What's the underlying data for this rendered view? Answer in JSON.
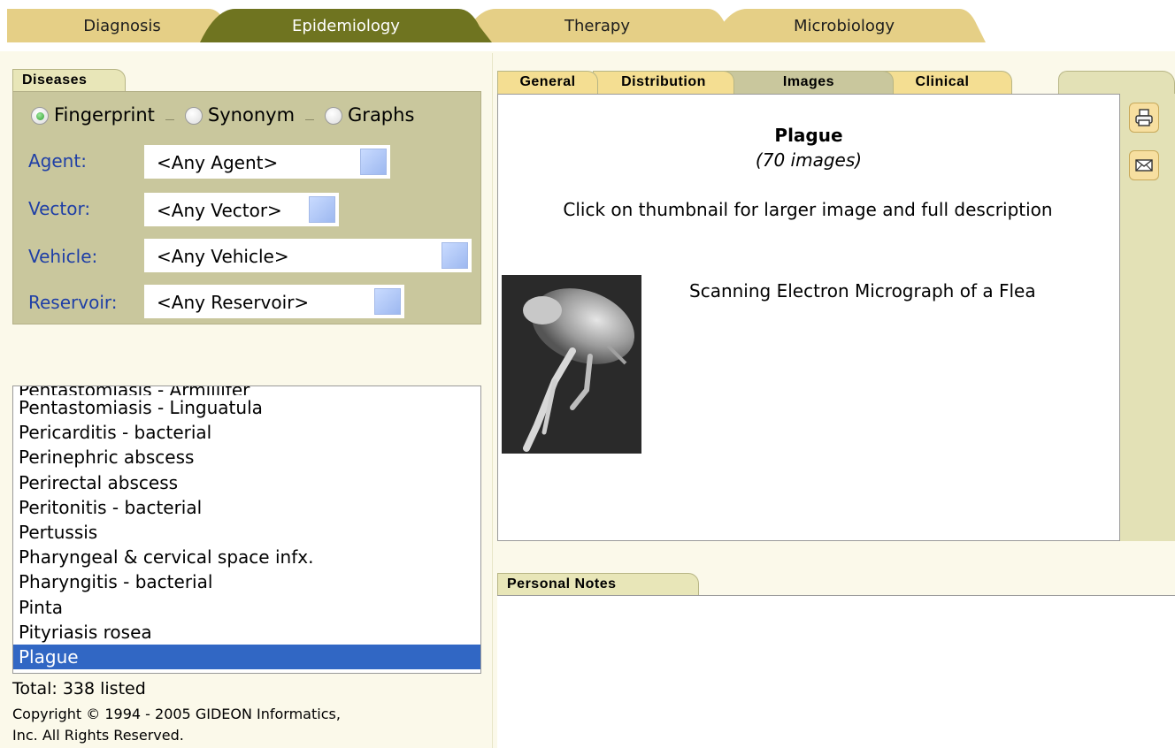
{
  "module_tabs": [
    {
      "label": "Diagnosis",
      "active": false
    },
    {
      "label": "Epidemiology",
      "active": true
    },
    {
      "label": "Therapy",
      "active": false
    },
    {
      "label": "Microbiology",
      "active": false
    }
  ],
  "left": {
    "panel_title": "Diseases",
    "radios": [
      {
        "label": "Fingerprint",
        "selected": true
      },
      {
        "label": "Synonym",
        "selected": false
      },
      {
        "label": "Graphs",
        "selected": false
      }
    ],
    "filters": {
      "agent": {
        "label": "Agent:",
        "value": "<Any Agent>"
      },
      "vector": {
        "label": "Vector:",
        "value": "<Any Vector>"
      },
      "vehicle": {
        "label": "Vehicle:",
        "value": "<Any Vehicle>"
      },
      "reservoir": {
        "label": "Reservoir:",
        "value": "<Any Reservoir>"
      }
    },
    "list": {
      "clipped_top": "Pentastomiasis - Armillifer",
      "items": [
        "Pentastomiasis - Linguatula",
        "Pericarditis - bacterial",
        "Perinephric abscess",
        "Perirectal abscess",
        "Peritonitis - bacterial",
        "Pertussis",
        "Pharyngeal & cervical space infx.",
        "Pharyngitis - bacterial",
        "Pinta",
        "Pityriasis rosea",
        "Plague"
      ],
      "selected": "Plague"
    },
    "total": "Total: 338 listed",
    "copyright_line1": "Copyright © 1994 - 2005 GIDEON Informatics,",
    "copyright_line2": "Inc. All Rights Reserved."
  },
  "right": {
    "tabs": [
      "General",
      "Distribution",
      "Images",
      "Clinical"
    ],
    "active_tab": "Images",
    "content": {
      "title": "Plague",
      "count": "(70 images)",
      "instruction": "Click on thumbnail for larger image and full description",
      "image_caption": "Scanning Electron Micrograph of a Flea"
    },
    "side_buttons": {
      "print_icon": "printer-icon",
      "email_icon": "envelope-icon"
    },
    "notes_title": "Personal Notes"
  },
  "colors": {
    "active_tab": "#6f7420",
    "inactive_tab": "#e5cf86",
    "panel": "#c9c79d",
    "selection": "#3167c4",
    "filter_label": "#1f3fa6"
  }
}
